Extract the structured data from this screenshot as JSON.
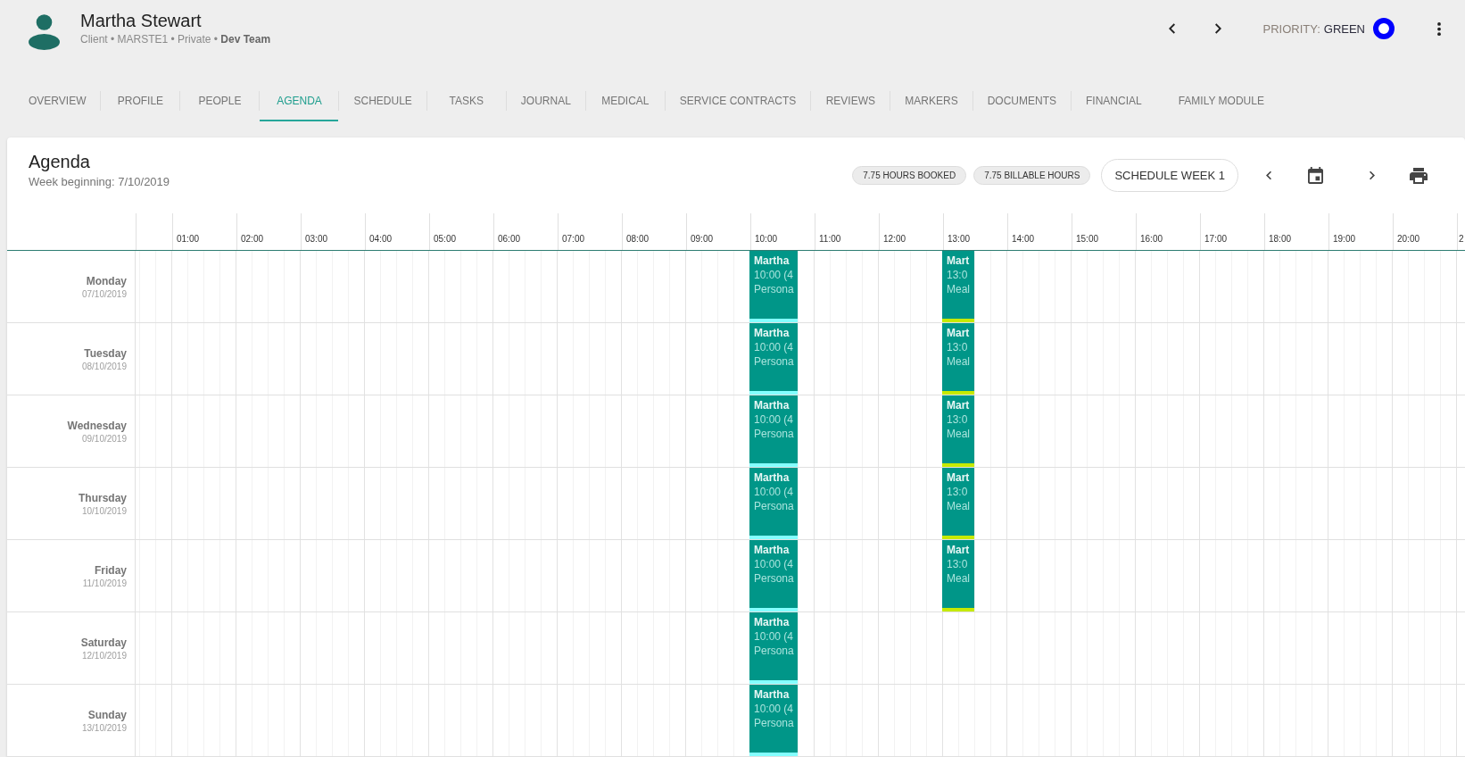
{
  "header": {
    "name": "Martha Stewart",
    "details": "Client • MARSTE1 • Private • **Dev Team**",
    "priority_label": "PRIORITY:",
    "priority_value": "GREEN"
  },
  "tabs": [
    {
      "label": "OVERVIEW",
      "selected": false
    },
    {
      "label": "PROFILE",
      "selected": false
    },
    {
      "label": "PEOPLE",
      "selected": false
    },
    {
      "label": "AGENDA",
      "selected": true
    },
    {
      "label": "SCHEDULE",
      "selected": false
    },
    {
      "label": "TASKS",
      "selected": false
    },
    {
      "label": "JOURNAL",
      "selected": false
    },
    {
      "label": "MEDICAL",
      "selected": false
    },
    {
      "label": "SERVICE CONTRACTS",
      "selected": false
    },
    {
      "label": "REVIEWS",
      "selected": false
    },
    {
      "label": "MARKERS",
      "selected": false
    },
    {
      "label": "DOCUMENTS",
      "selected": false
    },
    {
      "label": "FINANCIAL",
      "selected": false
    },
    {
      "label": "FAMILY MODULE",
      "selected": false
    }
  ],
  "agenda": {
    "title": "Agenda",
    "week": "Week beginning: 7/10/2019",
    "chips": [
      "7.75 HOURS BOOKED",
      "7.75 BILLABLE HOURS"
    ],
    "schedule_button": "SCHEDULE WEEK 1",
    "hours": [
      "01:00",
      "02:00",
      "03:00",
      "04:00",
      "05:00",
      "06:00",
      "07:00",
      "08:00",
      "09:00",
      "10:00",
      "11:00",
      "12:00",
      "13:00",
      "14:00",
      "15:00",
      "16:00",
      "17:00",
      "18:00",
      "19:00",
      "20:00",
      "2"
    ],
    "days": [
      {
        "name": "Monday",
        "date": "07/10/2019",
        "events": [
          {
            "kind": "long",
            "title": "Martha",
            "time": "10:00 (4",
            "detail": "Persona",
            "color": "#84ffff"
          },
          {
            "kind": "short",
            "title": "Mart",
            "time": "13:0",
            "detail": "Meal",
            "color": "#c6ea00"
          }
        ]
      },
      {
        "name": "Tuesday",
        "date": "08/10/2019",
        "events": [
          {
            "kind": "long",
            "title": "Martha",
            "time": "10:00 (4",
            "detail": "Persona",
            "color": "#84ffff"
          },
          {
            "kind": "short",
            "title": "Mart",
            "time": "13:0",
            "detail": "Meal",
            "color": "#c6ea00"
          }
        ]
      },
      {
        "name": "Wednesday",
        "date": "09/10/2019",
        "events": [
          {
            "kind": "long",
            "title": "Martha",
            "time": "10:00 (4",
            "detail": "Persona",
            "color": "#84ffff"
          },
          {
            "kind": "short",
            "title": "Mart",
            "time": "13:0",
            "detail": "Meal",
            "color": "#c6ea00"
          }
        ]
      },
      {
        "name": "Thursday",
        "date": "10/10/2019",
        "events": [
          {
            "kind": "long",
            "title": "Martha",
            "time": "10:00 (4",
            "detail": "Persona",
            "color": "#84ffff"
          },
          {
            "kind": "short",
            "title": "Mart",
            "time": "13:0",
            "detail": "Meal",
            "color": "#c6ea00"
          }
        ]
      },
      {
        "name": "Friday",
        "date": "11/10/2019",
        "events": [
          {
            "kind": "long",
            "title": "Martha",
            "time": "10:00 (4",
            "detail": "Persona",
            "color": "#84ffff"
          },
          {
            "kind": "short",
            "title": "Mart",
            "time": "13:0",
            "detail": "Meal",
            "color": "#c6ea00"
          }
        ]
      },
      {
        "name": "Saturday",
        "date": "12/10/2019",
        "events": [
          {
            "kind": "long",
            "title": "Martha",
            "time": "10:00 (4",
            "detail": "Persona",
            "color": "#84ffff"
          }
        ]
      },
      {
        "name": "Sunday",
        "date": "13/10/2019",
        "events": [
          {
            "kind": "long",
            "title": "Martha",
            "time": "10:00 (4",
            "detail": "Persona",
            "color": "#84ffff"
          }
        ]
      }
    ]
  }
}
